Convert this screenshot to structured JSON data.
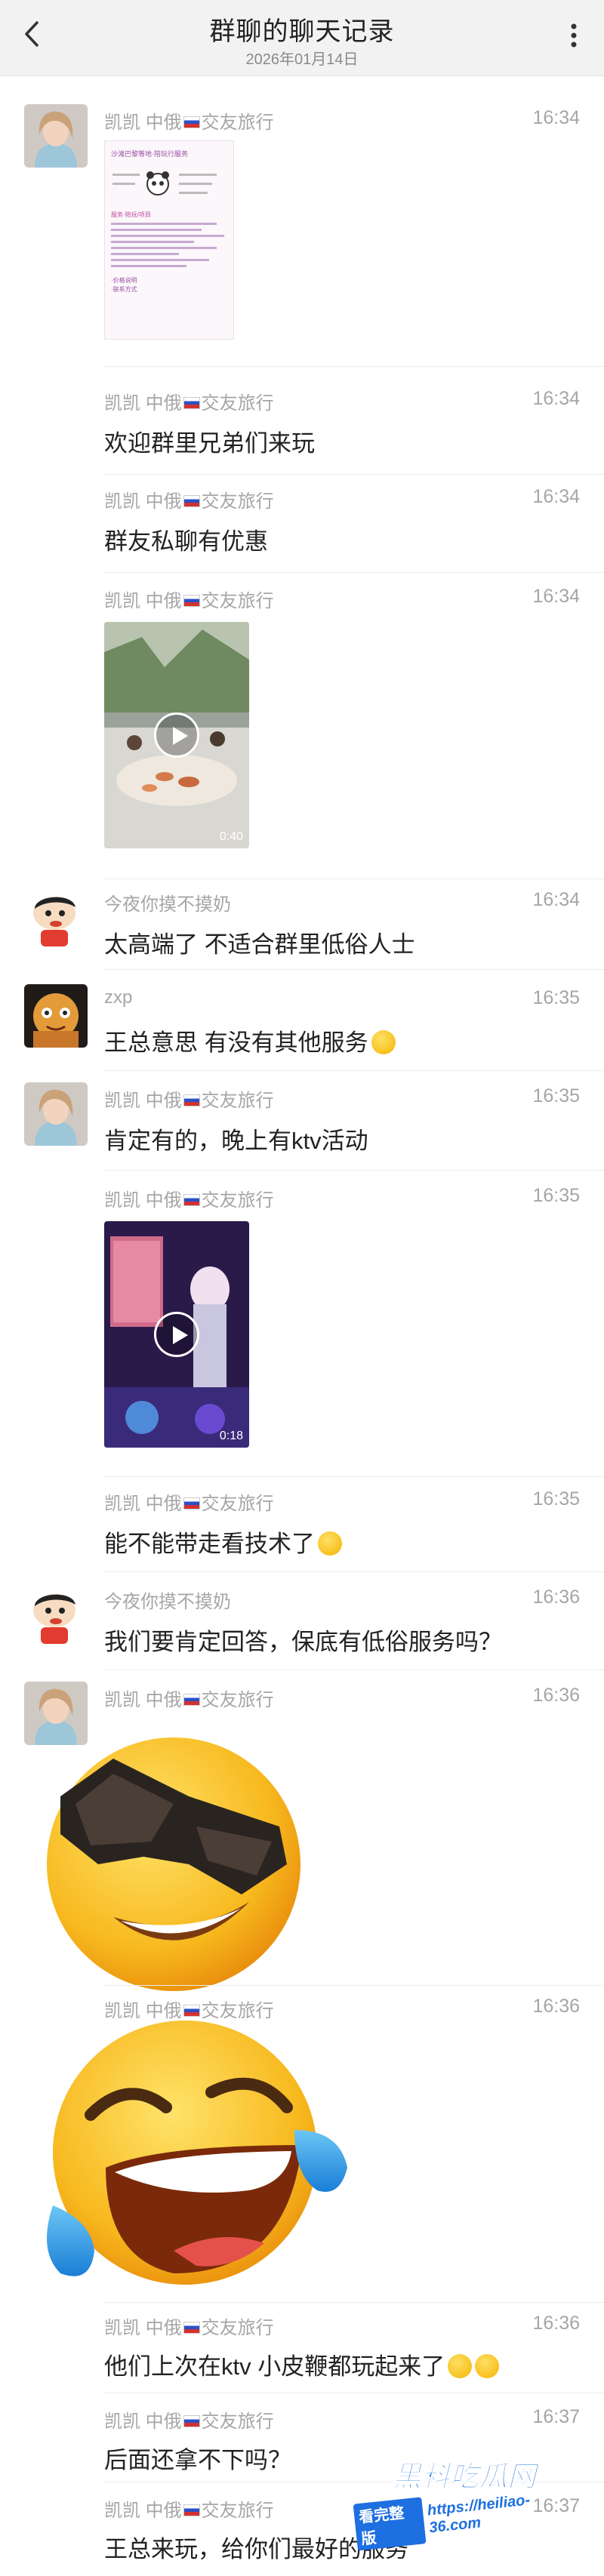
{
  "header": {
    "title": "群聊的聊天记录",
    "date": "2026年01月14日"
  },
  "senders": {
    "kaikai_pre": "凯凯 中俄",
    "kaikai_post": "交友旅行",
    "jinye": "今夜你摸不摸奶",
    "zxp": "zxp"
  },
  "messages": [
    {
      "time": "16:34",
      "poster_title": "沙滩巴黎等地·陪玩行服务",
      "poster_lines": [
        "服务·陪玩/项目",
        "·价格说明",
        "·联系方式"
      ]
    },
    {
      "time": "16:34",
      "text": "欢迎群里兄弟们来玩"
    },
    {
      "time": "16:34",
      "text": "群友私聊有优惠"
    },
    {
      "time": "16:34",
      "video_duration": "0:40"
    },
    {
      "time": "16:34",
      "text": "太高端了 不适合群里低俗人士"
    },
    {
      "time": "16:35",
      "text": "王总意思 有没有其他服务"
    },
    {
      "time": "16:35",
      "text": "肯定有的，晚上有ktv活动"
    },
    {
      "time": "16:35",
      "video_duration": "0:18"
    },
    {
      "time": "16:35",
      "text": "能不能带走看技术了"
    },
    {
      "time": "16:36",
      "text": "我们要肯定回答，保底有低俗服务吗？"
    },
    {
      "time": "16:36",
      "sticker": "sunglasses-emoji"
    },
    {
      "time": "16:36",
      "sticker": "laughing-tears-emoji"
    },
    {
      "time": "16:36",
      "text": "他们上次在ktv 小皮鞭都玩起来了"
    },
    {
      "time": "16:37",
      "text": "后面还拿不下吗？"
    },
    {
      "time": "16:37",
      "text": "王总来玩，给你们最好的服务"
    }
  ],
  "watermark": {
    "brand": "黑料吃瓜网",
    "sub": "看完整版",
    "url": "https://heiliao-36.com"
  }
}
